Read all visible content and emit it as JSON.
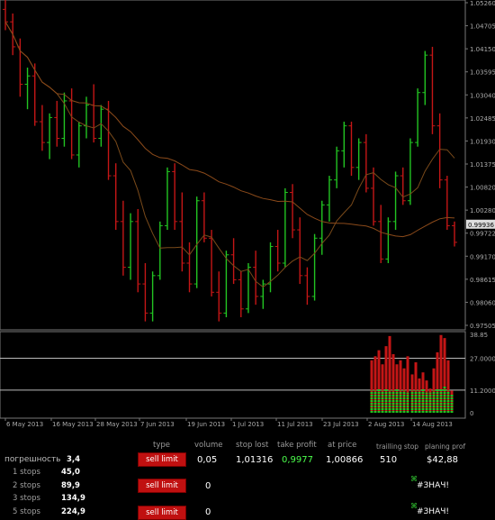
{
  "chart": {
    "price_labels": [
      "1.05260",
      "1.04705",
      "1.04150",
      "1.03595",
      "1.03040",
      "1.02485",
      "1.01930",
      "1.01375",
      "1.00820",
      "1.00280",
      "0.99722",
      "0.99170",
      "0.98615",
      "0.98060",
      "0.97505"
    ],
    "current_price": "0.99936",
    "indicator_labels": [
      "38.85",
      "27.0000",
      "11.2000",
      "0"
    ],
    "date_labels": [
      "6 May 2013",
      "16 May 2013",
      "28 May 2013",
      "7 Jun 2013",
      "19 Jun 2013",
      "1 Jul 2013",
      "11 Jul 2013",
      "23 Jul 2013",
      "2 Aug 2013",
      "14 Aug 2013"
    ],
    "colors": {
      "bull": "#22c422",
      "bear": "#c41616",
      "ma_slow": "#8b4a1a",
      "ma_fast": "#7a4a1a",
      "level": "#bbbbbb"
    }
  },
  "chart_data": {
    "type": "candlestick",
    "x": [
      "6 May 2013",
      "16 May 2013",
      "28 May 2013",
      "7 Jun 2013",
      "19 Jun 2013",
      "1 Jul 2013",
      "11 Jul 2013",
      "23 Jul 2013",
      "2 Aug 2013",
      "14 Aug 2013"
    ],
    "series": [
      {
        "values": [
          [
            1.051,
            1.054,
            1.046,
            1.048
          ],
          [
            1.048,
            1.05,
            1.04,
            1.042
          ],
          [
            1.042,
            1.044,
            1.03,
            1.033
          ],
          [
            1.033,
            1.037,
            1.027,
            1.035
          ],
          [
            1.035,
            1.038,
            1.023,
            1.024
          ],
          [
            1.024,
            1.028,
            1.017,
            1.019
          ],
          [
            1.019,
            1.026,
            1.015,
            1.025
          ],
          [
            1.025,
            1.029,
            1.018,
            1.02
          ],
          [
            1.02,
            1.031,
            1.018,
            1.029
          ],
          [
            1.029,
            1.032,
            1.015,
            1.016
          ],
          [
            1.016,
            1.024,
            1.013,
            1.023
          ],
          [
            1.023,
            1.03,
            1.02,
            1.028
          ],
          [
            1.028,
            1.033,
            1.019,
            1.02
          ],
          [
            1.02,
            1.028,
            1.018,
            1.027
          ],
          [
            1.027,
            1.029,
            1.01,
            1.011
          ],
          [
            1.011,
            1.014,
            0.998,
            1.0
          ],
          [
            1.0,
            1.005,
            0.987,
            0.989
          ],
          [
            0.989,
            1.002,
            0.986,
            1.0
          ],
          [
            1.0,
            1.003,
            0.983,
            0.985
          ],
          [
            0.985,
            0.99,
            0.976,
            0.978
          ],
          [
            0.978,
            0.988,
            0.976,
            0.987
          ],
          [
            0.987,
            1.0,
            0.986,
            0.999
          ],
          [
            0.999,
            1.013,
            0.998,
            1.012
          ],
          [
            1.012,
            1.014,
            0.998,
            1.0
          ],
          [
            1.0,
            1.007,
            0.988,
            0.99
          ],
          [
            0.99,
            0.995,
            0.983,
            0.985
          ],
          [
            0.985,
            1.006,
            0.984,
            1.005
          ],
          [
            1.005,
            1.007,
            0.995,
            0.996
          ],
          [
            0.996,
            0.998,
            0.982,
            0.983
          ],
          [
            0.983,
            0.988,
            0.976,
            0.978
          ],
          [
            0.978,
            0.993,
            0.977,
            0.992
          ],
          [
            0.992,
            0.996,
            0.985,
            0.986
          ],
          [
            0.986,
            0.988,
            0.977,
            0.979
          ],
          [
            0.979,
            0.99,
            0.978,
            0.989
          ],
          [
            0.989,
            0.993,
            0.98,
            0.982
          ],
          [
            0.982,
            0.986,
            0.979,
            0.985
          ],
          [
            0.985,
            0.995,
            0.983,
            0.994
          ],
          [
            0.994,
            0.998,
            0.988,
            0.99
          ],
          [
            0.99,
            1.008,
            0.989,
            1.007
          ],
          [
            1.007,
            1.009,
            0.996,
            0.998
          ],
          [
            0.998,
            1.001,
            0.985,
            0.987
          ],
          [
            0.987,
            0.989,
            0.98,
            0.982
          ],
          [
            0.982,
            0.997,
            0.981,
            0.996
          ],
          [
            0.996,
            1.005,
            0.992,
            1.004
          ],
          [
            1.004,
            1.011,
            1.0,
            1.01
          ],
          [
            1.01,
            1.018,
            1.008,
            1.017
          ],
          [
            1.017,
            1.024,
            1.013,
            1.023
          ],
          [
            1.023,
            1.024,
            1.011,
            1.013
          ],
          [
            1.013,
            1.02,
            1.01,
            1.019
          ],
          [
            1.019,
            1.021,
            1.007,
            1.008
          ],
          [
            1.008,
            1.013,
            0.999,
            1.0
          ],
          [
            1.0,
            1.004,
            0.99,
            0.991
          ],
          [
            0.991,
            1.001,
            0.99,
            1.0
          ],
          [
            1.0,
            1.012,
            0.998,
            1.011
          ],
          [
            1.011,
            1.013,
            1.004,
            1.005
          ],
          [
            1.005,
            1.02,
            1.004,
            1.019
          ],
          [
            1.019,
            1.032,
            1.018,
            1.031
          ],
          [
            1.031,
            1.041,
            1.028,
            1.04
          ],
          [
            1.04,
            1.042,
            1.021,
            1.023
          ],
          [
            1.023,
            1.026,
            1.008,
            1.01
          ],
          [
            1.01,
            1.011,
            0.998,
            0.999
          ],
          [
            0.999,
            1.0,
            0.994,
            0.995
          ]
        ]
      }
    ],
    "ylim": [
      0.97505,
      1.0526
    ],
    "type_note": "OHLC price bars with two moving averages and a bar-histogram indicator"
  },
  "panel": {
    "headers": {
      "type": "type",
      "volume": "volume",
      "stop_lost": "stop lost",
      "take_profit": "take profit",
      "at_price": "at price",
      "trailing_stop": "trailling stop",
      "planing_prof": "planing prof"
    },
    "error_label": "погрешность",
    "error_value": "3,4",
    "stops": [
      {
        "label": "1 stops",
        "value": "45,0"
      },
      {
        "label": "2 stops",
        "value": "89,9"
      },
      {
        "label": "3 stops",
        "value": "134,9"
      },
      {
        "label": "5 stops",
        "value": "224,9"
      }
    ],
    "rows": [
      {
        "type": "sell limit",
        "volume": "0,05",
        "stop_lost": "1,01316",
        "take_profit": "0,9977",
        "at_price": "1,00866",
        "trailing": "510",
        "planing": "$42,88"
      },
      {
        "type": "sell limit",
        "volume": "0",
        "planing": "#ЗНАЧ!"
      },
      {
        "type": "sell limit",
        "volume": "0",
        "planing": "#ЗНАЧ!"
      }
    ]
  }
}
